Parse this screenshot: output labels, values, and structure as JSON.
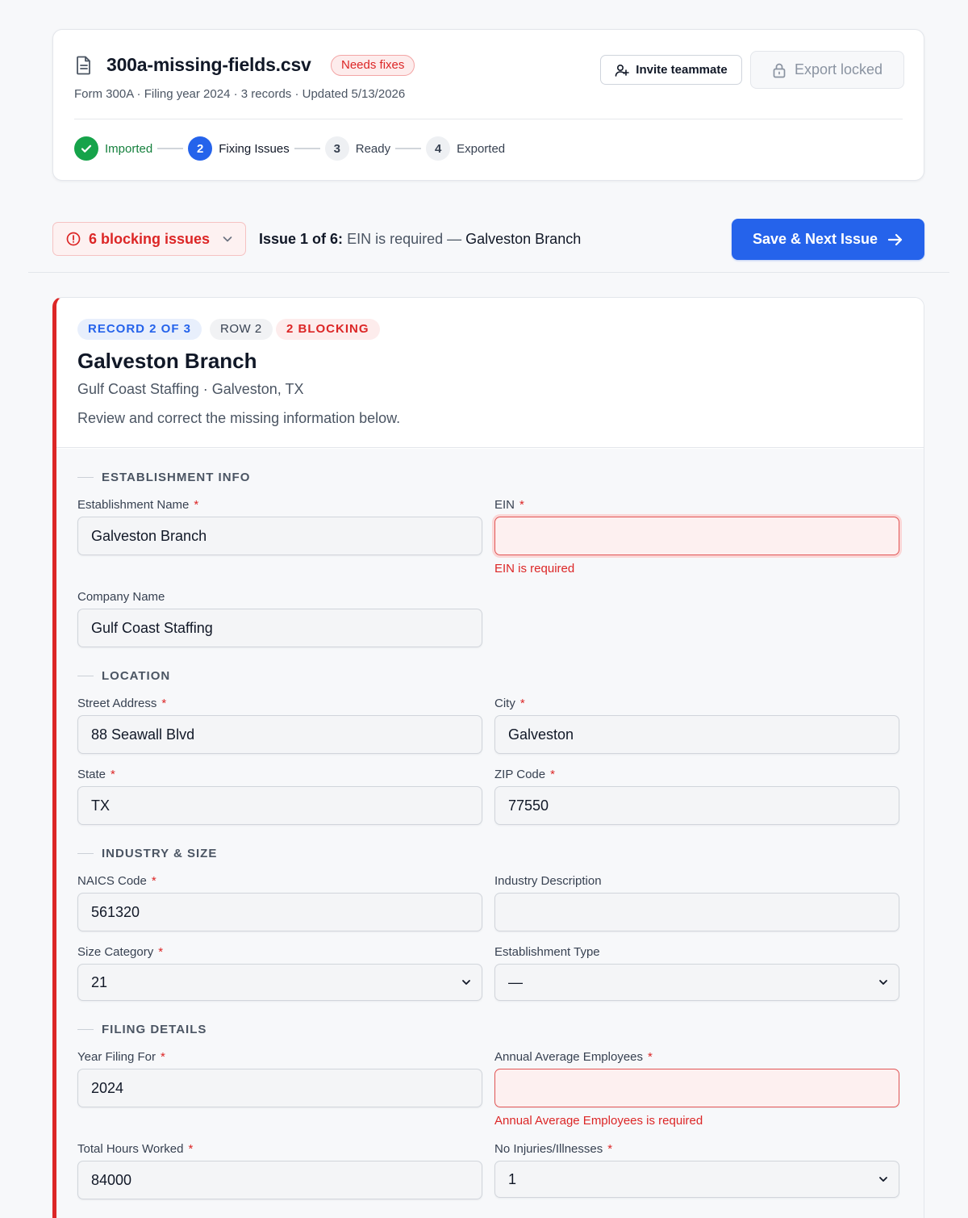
{
  "header": {
    "file_name": "300a-missing-fields.csv",
    "status_badge": "Needs fixes",
    "meta": "Form 300A · Filing year 2024 · 3 records · Updated 5/13/2026",
    "invite_label": "Invite teammate",
    "export_label": "Export locked",
    "steps": [
      {
        "number": "",
        "label": "Imported",
        "state": "done"
      },
      {
        "number": "2",
        "label": "Fixing Issues",
        "state": "active"
      },
      {
        "number": "3",
        "label": "Ready",
        "state": "todo"
      },
      {
        "number": "4",
        "label": "Exported",
        "state": "todo"
      }
    ]
  },
  "issue_bar": {
    "blocking_label": "6 blocking issues",
    "issue_prefix": "Issue 1 of 6:",
    "issue_message": "EIN is required —",
    "issue_record": "Galveston Branch",
    "save_label": "Save & Next Issue"
  },
  "record": {
    "record_tag": "RECORD 2 OF 3",
    "row_tag": "ROW 2",
    "blocking_tag": "2 BLOCKING",
    "title": "Galveston Branch",
    "subtitle": "Gulf Coast Staffing · Galveston, TX",
    "hint": "Review and correct the missing information below."
  },
  "sections": {
    "establishment": "ESTABLISHMENT INFO",
    "location": "LOCATION",
    "industry": "INDUSTRY & SIZE",
    "filing": "FILING DETAILS"
  },
  "fields": {
    "establishment_name": {
      "label": "Establishment Name",
      "required": "*",
      "value": "Galveston Branch"
    },
    "ein": {
      "label": "EIN",
      "required": "*",
      "value": "",
      "error": "EIN is required"
    },
    "company_name": {
      "label": "Company Name",
      "value": "Gulf Coast Staffing"
    },
    "street": {
      "label": "Street Address",
      "required": "*",
      "value": "88 Seawall Blvd"
    },
    "city": {
      "label": "City",
      "required": "*",
      "value": "Galveston"
    },
    "state": {
      "label": "State",
      "required": "*",
      "value": "TX"
    },
    "zip": {
      "label": "ZIP Code",
      "required": "*",
      "value": "77550"
    },
    "naics": {
      "label": "NAICS Code",
      "required": "*",
      "value": "561320"
    },
    "industry_desc": {
      "label": "Industry Description",
      "value": ""
    },
    "size_category": {
      "label": "Size Category",
      "required": "*",
      "value": "21"
    },
    "establishment_type": {
      "label": "Establishment Type",
      "value": "—"
    },
    "year": {
      "label": "Year Filing For",
      "required": "*",
      "value": "2024"
    },
    "avg_employees": {
      "label": "Annual Average Employees",
      "required": "*",
      "value": "",
      "error": "Annual Average Employees is required"
    },
    "hours": {
      "label": "Total Hours Worked",
      "required": "*",
      "value": "84000"
    },
    "no_injuries": {
      "label": "No Injuries/Illnesses",
      "required": "*",
      "value": "1"
    }
  },
  "colors": {
    "accent": "#2563eb",
    "error": "#dc2626",
    "success": "#16a34a"
  }
}
